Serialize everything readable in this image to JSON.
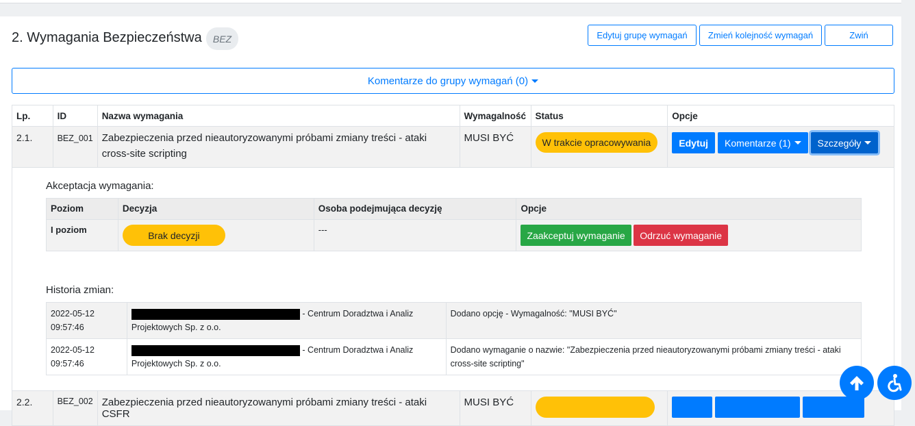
{
  "group": {
    "title": "2. Wymagania Bezpieczeństwa",
    "code": "BEZ",
    "buttons": {
      "edit_group": "Edytuj grupę wymagań",
      "reorder": "Zmień kolejność wymagań",
      "collapse": "Zwiń"
    },
    "comments_label": "Komentarze do grupy wymagań (0)"
  },
  "table": {
    "headers": [
      "Lp.",
      "ID",
      "Nazwa wymagania",
      "Wymagalność",
      "Status",
      "Opcje"
    ],
    "rows": [
      {
        "lp": "2.1.",
        "id": "BEZ_001",
        "name": "Zabezpieczenia przed nieautoryzowanymi próbami zmiany treści - ataki cross-site scripting",
        "requirement": "MUSI BYĆ",
        "status": "W trakcie opracowywania",
        "edit": "Edytuj",
        "comments": "Komentarze (1)",
        "details": "Szczegóły"
      },
      {
        "lp": "2.2.",
        "id": "BEZ_002",
        "name": "Zabezpieczenia przed nieautoryzowanymi próbami zmiany treści - ataki CSFR",
        "requirement": "MUSI BYĆ"
      }
    ]
  },
  "acceptance": {
    "title": "Akceptacja wymagania:",
    "headers": [
      "Poziom",
      "Decyzja",
      "Osoba podejmująca decyzję",
      "Opcje"
    ],
    "row": {
      "level": "I poziom",
      "decision": "Brak decyzji",
      "person": "---",
      "accept": "Zaakceptuj wymaganie",
      "reject": "Odrzuć wymaganie"
    }
  },
  "history": {
    "title": "Historia zmian:",
    "rows": [
      {
        "date": "2022-05-12",
        "time": "09:57:46",
        "org_line1": "- Centrum Doradztwa i Analiz",
        "org_line2": "Projektowych Sp. z o.o.",
        "change": "Dodano opcję - Wymagalność: \"MUSI BYĆ\""
      },
      {
        "date": "2022-05-12",
        "time": "09:57:46",
        "org_line1": "- Centrum Doradztwa i Analiz",
        "org_line2": "Projektowych Sp. z o.o.",
        "change": "Dodano wymaganie o nazwie: \"Zabezpieczenia przed nieautoryzowanymi próbami zmiany treści - ataki cross-site scripting\""
      }
    ]
  },
  "icons": {
    "scroll_top": "arrow-up-icon",
    "accessibility": "accessibility-icon"
  },
  "colors": {
    "primary": "#007bff",
    "warning": "#ffc107",
    "success": "#28a745",
    "danger": "#dc3545"
  }
}
